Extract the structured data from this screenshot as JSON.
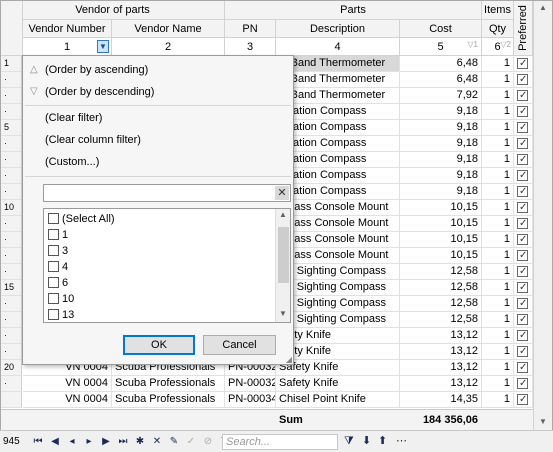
{
  "bands": {
    "vendor": "Vendor of parts",
    "parts": "Parts",
    "items": "Items"
  },
  "columns": [
    "Vendor Number",
    "Vendor Name",
    "PN",
    "Description",
    "Cost",
    "Qty",
    "Preferred"
  ],
  "col_index": [
    "1",
    "2",
    "3",
    "4",
    "5",
    "6"
  ],
  "row_markers": [
    "1",
    "·",
    "·",
    "·",
    "5",
    "·",
    "·",
    "·",
    "·",
    "10",
    "·",
    "·",
    "·",
    "·",
    "15",
    "·",
    "·",
    "·",
    "·",
    "20",
    "·"
  ],
  "rows": [
    {
      "vn": "",
      "name": "",
      "pn": "",
      "desc": "st Band Thermometer",
      "cost": "6,48",
      "qty": "1"
    },
    {
      "vn": "",
      "name": "",
      "pn": "",
      "desc": "st Band Thermometer",
      "cost": "6,48",
      "qty": "1"
    },
    {
      "vn": "",
      "name": "",
      "pn": "",
      "desc": "st Band Thermometer",
      "cost": "7,92",
      "qty": "1"
    },
    {
      "vn": "",
      "name": "",
      "pn": "",
      "desc": "vigation Compass",
      "cost": "9,18",
      "qty": "1"
    },
    {
      "vn": "",
      "name": "",
      "pn": "",
      "desc": "vigation Compass",
      "cost": "9,18",
      "qty": "1"
    },
    {
      "vn": "",
      "name": "",
      "pn": "",
      "desc": "vigation Compass",
      "cost": "9,18",
      "qty": "1"
    },
    {
      "vn": "",
      "name": "",
      "pn": "",
      "desc": "vigation Compass",
      "cost": "9,18",
      "qty": "1"
    },
    {
      "vn": "",
      "name": "",
      "pn": "",
      "desc": "vigation Compass",
      "cost": "9,18",
      "qty": "1"
    },
    {
      "vn": "",
      "name": "",
      "pn": "",
      "desc": "vigation Compass",
      "cost": "9,18",
      "qty": "1"
    },
    {
      "vn": "",
      "name": "",
      "pn": "",
      "desc": "mpass Console Mount",
      "cost": "10,15",
      "qty": "1"
    },
    {
      "vn": "",
      "name": "",
      "pn": "",
      "desc": "mpass Console Mount",
      "cost": "10,15",
      "qty": "1"
    },
    {
      "vn": "",
      "name": "",
      "pn": "",
      "desc": "mpass Console Mount",
      "cost": "10,15",
      "qty": "1"
    },
    {
      "vn": "",
      "name": "",
      "pn": "",
      "desc": "mpass Console Mount",
      "cost": "10,15",
      "qty": "1"
    },
    {
      "vn": "",
      "name": "",
      "pn": "",
      "desc": "ect Sighting Compass",
      "cost": "12,58",
      "qty": "1"
    },
    {
      "vn": "",
      "name": "",
      "pn": "",
      "desc": "ect Sighting Compass",
      "cost": "12,58",
      "qty": "1"
    },
    {
      "vn": "",
      "name": "",
      "pn": "",
      "desc": "ect Sighting Compass",
      "cost": "12,58",
      "qty": "1"
    },
    {
      "vn": "",
      "name": "",
      "pn": "",
      "desc": "ect Sighting Compass",
      "cost": "12,58",
      "qty": "1"
    },
    {
      "vn": "",
      "name": "",
      "pn": "",
      "desc": "afety Knife",
      "cost": "13,12",
      "qty": "1"
    },
    {
      "vn": "",
      "name": "",
      "pn": "",
      "desc": "afety Knife",
      "cost": "13,12",
      "qty": "1"
    },
    {
      "vn": "VN 0004",
      "name": "Scuba Professionals",
      "pn": "PN-00032",
      "desc": "Safety Knife",
      "cost": "13,12",
      "qty": "1"
    },
    {
      "vn": "VN 0004",
      "name": "Scuba Professionals",
      "pn": "PN-00032",
      "desc": "Safety Knife",
      "cost": "13,12",
      "qty": "1"
    },
    {
      "vn": "VN 0004",
      "name": "Scuba Professionals",
      "pn": "PN-00034",
      "desc": "Chisel Point Knife",
      "cost": "14,35",
      "qty": "1"
    }
  ],
  "footer": {
    "label": "Sum",
    "total": "184 356,06"
  },
  "nav": {
    "count": "945",
    "search_placeholder": "Search..."
  },
  "popup": {
    "sort_asc": "(Order by ascending)",
    "sort_desc": "(Order by descending)",
    "clear_filter": "(Clear filter)",
    "clear_column_filter": "(Clear column filter)",
    "custom": "(Custom...)",
    "items": [
      "(Select All)",
      "1",
      "3",
      "4",
      "6",
      "10",
      "13"
    ],
    "ok": "OK",
    "cancel": "Cancel"
  }
}
